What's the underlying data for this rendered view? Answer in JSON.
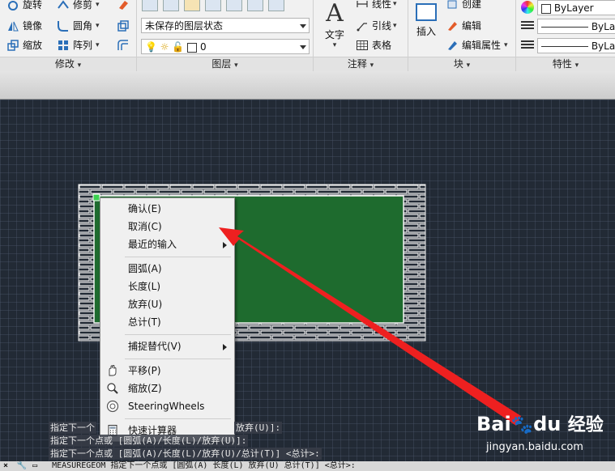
{
  "ribbon": {
    "modify": {
      "title": "修改",
      "rotate": "旋转",
      "trim": "修剪",
      "mirror": "镜像",
      "fillet": "圆角",
      "scale": "缩放",
      "array": "阵列"
    },
    "layers": {
      "title": "图层",
      "layer_state": "未保存的图层状态",
      "current_layer": "0"
    },
    "annotation": {
      "title": "注释",
      "text": "文字",
      "leader_top": "线性",
      "leader": "引线",
      "table": "表格"
    },
    "block": {
      "title": "块",
      "insert": "插入",
      "create": "创建",
      "edit": "编辑",
      "edit_attributes": "编辑属性"
    },
    "properties": {
      "title": "特性",
      "color": "ByLayer",
      "linetype": "ByLa",
      "lineweight": "ByLa"
    }
  },
  "context_menu": {
    "items": [
      {
        "label": "确认(E)"
      },
      {
        "label": "取消(C)"
      },
      {
        "label": "最近的输入"
      },
      {
        "label": "圆弧(A)"
      },
      {
        "label": "长度(L)"
      },
      {
        "label": "放弃(U)"
      },
      {
        "label": "总计(T)"
      },
      {
        "label": "捕捉替代(V)"
      },
      {
        "label": "平移(P)"
      },
      {
        "label": "缩放(Z)"
      },
      {
        "label": "SteeringWheels"
      },
      {
        "label": "快速计算器"
      }
    ]
  },
  "command_history": {
    "line1_left": "指定下一个",
    "line1_right": "放弃(U)]:",
    "line2": "指定下一个点或 [圆弧(A)/长度(L)/放弃(U)]:",
    "line3": "指定下一个点或 [圆弧(A)/长度(L)/放弃(U)/总计(T)] <总计>:"
  },
  "command_line": {
    "text": "MEASUREGEOM 指定下一个点或 [圆弧(A) 长度(L) 放弃(U) 总计(T)] <总计>:"
  },
  "watermark": {
    "brand": "Bai",
    "brand2": "du",
    "cn": "经验",
    "url": "jingyan.baidu.com"
  },
  "colors": {
    "fill": "#1e6b2e",
    "arrow": "#ee2020",
    "canvas": "#222a35"
  }
}
